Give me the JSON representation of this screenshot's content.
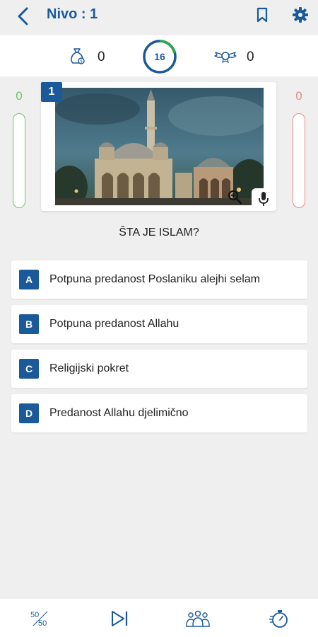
{
  "header": {
    "level_title": "Nivo : 1"
  },
  "stats": {
    "left_value": "0",
    "timer": "16",
    "right_value": "0"
  },
  "score": {
    "correct": "0",
    "wrong": "0"
  },
  "question": {
    "number": "1",
    "text": "ŠTA JE ISLAM?"
  },
  "answers": [
    {
      "letter": "A",
      "text": "Potpuna predanost Poslaniku alejhi selam"
    },
    {
      "letter": "B",
      "text": "Potpuna predanost Allahu"
    },
    {
      "letter": "C",
      "text": "Religijski pokret"
    },
    {
      "letter": "D",
      "text": "Predanost Allahu djelimično"
    }
  ],
  "lifelines": {
    "fifty_fifty": "50 50"
  },
  "colors": {
    "accent": "#1a5a9a",
    "correct": "#6cc56c",
    "wrong": "#e88a8a",
    "timer_ring": "#2aa84a"
  },
  "icons": [
    "back-arrow-icon",
    "bookmark-icon",
    "gear-icon",
    "money-bag-icon",
    "wings-badge-icon",
    "zoom-icon",
    "mic-icon",
    "fifty-fifty-icon",
    "skip-icon",
    "audience-icon",
    "stopwatch-icon"
  ]
}
